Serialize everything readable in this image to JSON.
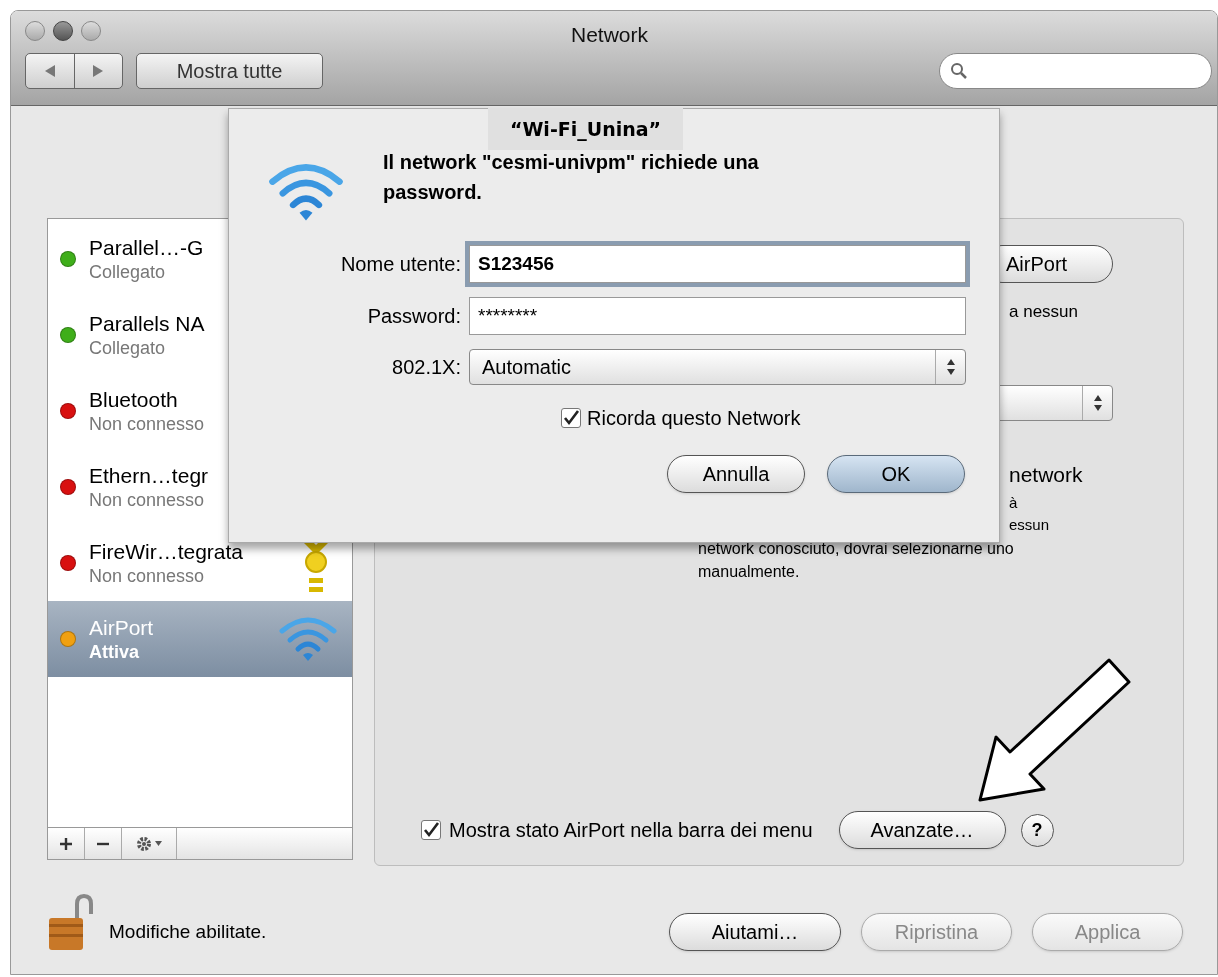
{
  "window": {
    "title": "Network"
  },
  "toolbar": {
    "show_all_button": "Mostra tutte"
  },
  "sidebar": {
    "items": [
      {
        "name": "Parallel…-G",
        "status": "Collegato",
        "color": "#3fae1a",
        "selected": false,
        "kind": "plain"
      },
      {
        "name": "Parallels NA",
        "status": "Collegato",
        "color": "#3fae1a",
        "selected": false,
        "kind": "plain"
      },
      {
        "name": "Bluetooth",
        "status": "Non connesso",
        "color": "#d81010",
        "selected": false,
        "kind": "plain"
      },
      {
        "name": "Ethern…tegr",
        "status": "Non connesso",
        "color": "#d81010",
        "selected": false,
        "kind": "plain"
      },
      {
        "name": "FireWir…tegrata",
        "status": "Non connesso",
        "color": "#d81010",
        "selected": false,
        "kind": "firewire"
      },
      {
        "name": "AirPort",
        "status": "Attiva",
        "color": "#f0a010",
        "selected": true,
        "kind": "wifi"
      }
    ]
  },
  "panel": {
    "airport_button": "AirPort",
    "fragment_1": "a nessun",
    "fragment_2": "network",
    "fragment_3": "à",
    "fragment_4": "essun",
    "description": "network conosciuto, dovrai selezionarne uno manualmente.",
    "menu_checkbox": {
      "label": "Mostra stato AirPort nella barra dei menu",
      "checked": true
    },
    "advanced_button": "Avanzate…",
    "help_button": "?"
  },
  "dialog": {
    "message": "Il network \"cesmi-univpm\" richiede una password.",
    "fields": [
      {
        "label": "Nome utente:",
        "value": "S123456",
        "kind": "text",
        "focused": true
      },
      {
        "label": "Password:",
        "value": "********",
        "kind": "text",
        "focused": false
      },
      {
        "label": "802.1X:",
        "value": "Automatic",
        "kind": "select",
        "focused": false
      }
    ],
    "remember": {
      "label": "Ricorda questo Network",
      "checked": true
    },
    "buttons": [
      {
        "label": "Annulla",
        "default": false
      },
      {
        "label": "OK",
        "default": true
      }
    ]
  },
  "annotation": "“Wi-Fi_Unina”",
  "footer": {
    "lock_text": "Modifiche abilitate.",
    "buttons": [
      {
        "label": "Aiutami…",
        "disabled": false
      },
      {
        "label": "Ripristina",
        "disabled": true
      },
      {
        "label": "Applica",
        "disabled": true
      }
    ]
  }
}
